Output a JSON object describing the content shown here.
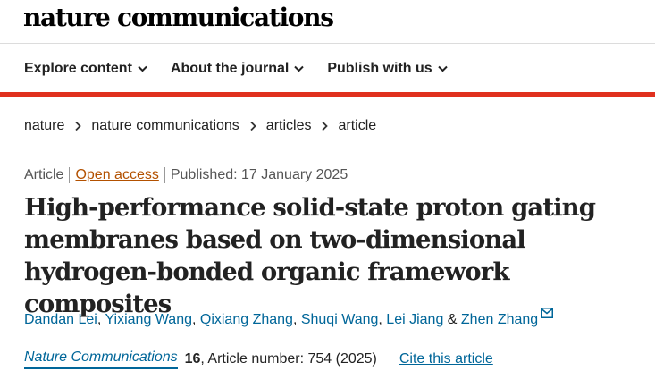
{
  "brand": {
    "name": "nature communications"
  },
  "nav": {
    "items": [
      {
        "label": "Explore content"
      },
      {
        "label": "About the journal"
      },
      {
        "label": "Publish with us"
      }
    ]
  },
  "breadcrumb": {
    "items": [
      "nature",
      "nature communications",
      "articles"
    ],
    "current": "article"
  },
  "meta": {
    "type": "Article",
    "access": "Open access",
    "published": "Published: 17 January 2025"
  },
  "article": {
    "title": "High-performance solid-state proton gating membranes based on two-dimensional hydrogen-bonded organic framework composites"
  },
  "authors": {
    "list": [
      "Dandan Lei",
      "Yixiang Wang",
      "Qixiang Zhang",
      "Shuqi Wang",
      "Lei Jiang",
      "Zhen Zhang"
    ],
    "comma": ", ",
    "and": " & "
  },
  "citation": {
    "journal": "Nature Communications",
    "volume": "16",
    "rest": ", Article number: 754 (2025)",
    "cite_label": "Cite this article"
  },
  "colors": {
    "accent_red": "#e0301e",
    "link_blue": "#006699",
    "open_access": "#b35100"
  },
  "icons": {
    "nav_chevron": "chevron-down-icon",
    "crumb_separator": "chevron-right-icon",
    "email": "envelope-icon"
  }
}
